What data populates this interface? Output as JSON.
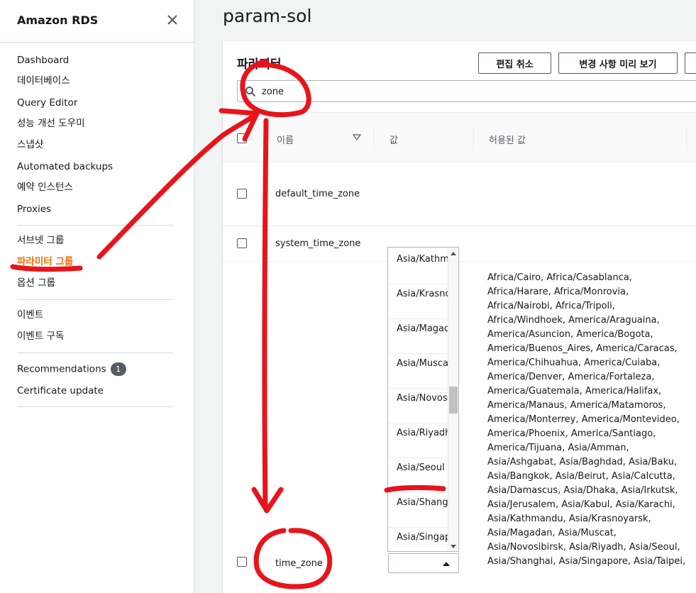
{
  "sidebar": {
    "title": "Amazon RDS",
    "items": [
      {
        "label": "Dashboard"
      },
      {
        "label": "데이터베이스"
      },
      {
        "label": "Query Editor"
      },
      {
        "label": "성능 개선 도우미"
      },
      {
        "label": "스냅샷"
      },
      {
        "label": "Automated backups"
      },
      {
        "label": "예약 인스턴스"
      },
      {
        "label": "Proxies"
      },
      {
        "label": "서브넷 그룹"
      },
      {
        "label": "파라미터 그룹"
      },
      {
        "label": "옵션 그룹"
      },
      {
        "label": "이벤트"
      },
      {
        "label": "이벤트 구독"
      },
      {
        "label": "Recommendations",
        "badge": "1"
      },
      {
        "label": "Certificate update"
      }
    ]
  },
  "page": {
    "title": "param-sol"
  },
  "panel": {
    "title": "파라미터",
    "buttons": {
      "cancel": "편집 취소",
      "preview": "변경 사항 미리 보기"
    },
    "search": {
      "value": "zone"
    },
    "columns": {
      "name": "이름",
      "value": "값",
      "allowed": "허용된 값"
    },
    "rows": [
      {
        "name": "default_time_zone"
      },
      {
        "name": "system_time_zone"
      },
      {
        "name": "time_zone",
        "allowed_values": "Africa/Cairo, Africa/Casablanca, Africa/Harare, Africa/Monrovia, Africa/Nairobi, Africa/Tripoli, Africa/Windhoek, America/Araguaina, America/Asuncion, America/Bogota, America/Buenos_Aires, America/Caracas, America/Chihuahua, America/Cuiaba, America/Denver, America/Fortaleza, America/Guatemala, America/Halifax, America/Manaus, America/Matamoros, America/Monterrey, America/Montevideo, America/Phoenix, America/Santiago, America/Tijuana, Asia/Amman, Asia/Ashgabat, Asia/Baghdad, Asia/Baku, Asia/Bangkok, Asia/Beirut, Asia/Calcutta, Asia/Damascus, Asia/Dhaka, Asia/Irkutsk, Asia/Jerusalem, Asia/Kabul, Asia/Karachi, Asia/Kathmandu, Asia/Krasnoyarsk, Asia/Magadan, Asia/Muscat, Asia/Novosibirsk, Asia/Riyadh, Asia/Seoul, Asia/Shanghai, Asia/Singapore, Asia/Taipei,"
      }
    ],
    "dropdown": {
      "options": [
        "Asia/Kathmandu",
        "Asia/Krasnoyarsk",
        "Asia/Magadan",
        "Asia/Muscat",
        "Asia/Novosibirsk",
        "Asia/Riyadh",
        "Asia/Seoul",
        "Asia/Shanghai",
        "Asia/Singapore"
      ],
      "selected": ""
    }
  },
  "colors": {
    "accent": "#ec7211",
    "annotation": "#e8141b",
    "text": "#16191f"
  },
  "icons": [
    "close-icon",
    "search-icon",
    "sort-down-icon",
    "caret-up-icon"
  ]
}
